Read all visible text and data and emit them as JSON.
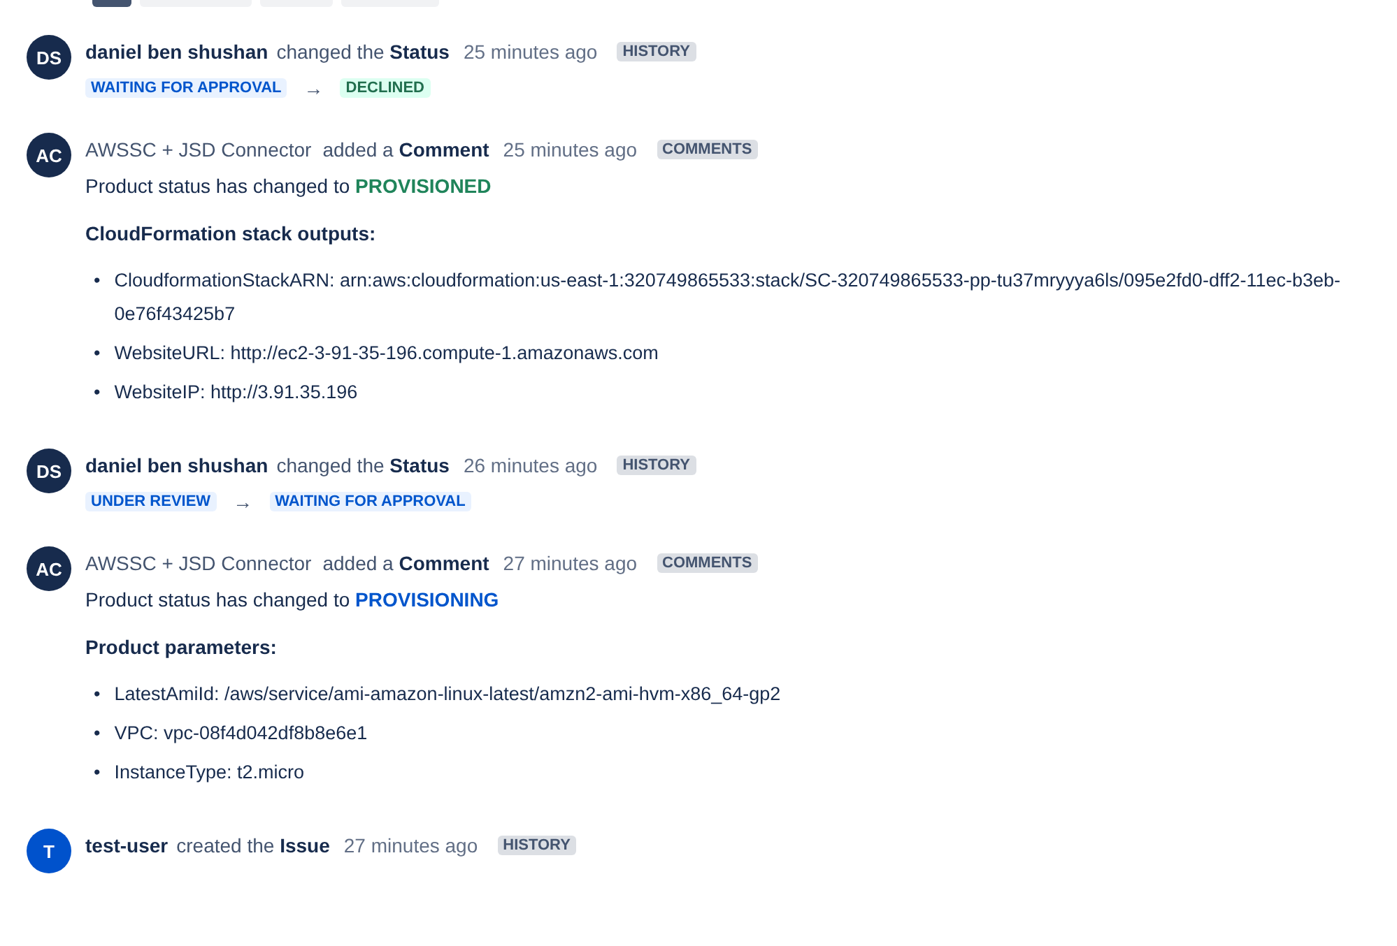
{
  "top_tabs": [
    {
      "selected": true
    },
    {
      "selected": false
    },
    {
      "selected": false
    },
    {
      "selected": false
    }
  ],
  "entries": [
    {
      "kind": "status_change",
      "initials": "DS",
      "color": "#172b4d",
      "author": {
        "name": "daniel ben shushan",
        "kind": "user"
      },
      "action": "changed the **Status**",
      "time": "25 minutes ago",
      "tag": "HISTORY",
      "from": {
        "label": "WAITING FOR APPROVAL",
        "kind": "in_progress"
      },
      "arrow": "→",
      "to": {
        "label": "DECLINED",
        "kind": "done"
      }
    },
    {
      "kind": "comment",
      "initials": "AC",
      "color": "#172b4d",
      "author": {
        "name": "AWSSC + JSD Connector",
        "kind": "app"
      },
      "action": "added a **Comment**",
      "time": "25 minutes ago",
      "tag": "COMMENTS",
      "text": "Product status has changed to",
      "status": {
        "label": "PROVISIONED",
        "kind": "done"
      },
      "heading": "CloudFormation stack outputs:",
      "items": [
        {
          "bullet": "•",
          "text": "CloudformationStackARN: arn:aws:cloudformation:us-east-1:320749865533:stack/SC-320749865533-pp-tu37mryyya6ls/095e2fd0-dff2-11ec-b3eb-0e76f43425b7"
        },
        {
          "bullet": "•",
          "text": "WebsiteURL: http://ec2-3-91-35-196.compute-1.amazonaws.com"
        },
        {
          "bullet": "•",
          "text": "WebsiteIP: http://3.91.35.196"
        }
      ]
    },
    {
      "kind": "status_change",
      "initials": "DS",
      "color": "#172b4d",
      "author": {
        "name": "daniel ben shushan",
        "kind": "user"
      },
      "action": "changed the **Status**",
      "time": "26 minutes ago",
      "tag": "HISTORY",
      "from": {
        "label": "UNDER REVIEW",
        "kind": "in_progress"
      },
      "arrow": "→",
      "to": {
        "label": "WAITING FOR APPROVAL",
        "kind": "in_progress"
      }
    },
    {
      "kind": "comment",
      "initials": "AC",
      "color": "#172b4d",
      "author": {
        "name": "AWSSC + JSD Connector",
        "kind": "app"
      },
      "action": "added a **Comment**",
      "time": "27 minutes ago",
      "tag": "COMMENTS",
      "text": "Product status has changed to",
      "status": {
        "label": "PROVISIONING",
        "kind": "in_progress"
      },
      "heading": "Product parameters:",
      "items": [
        {
          "bullet": "•",
          "text": "LatestAmiId: /aws/service/ami-amazon-linux-latest/amzn2-ami-hvm-x86_64-gp2"
        },
        {
          "bullet": "•",
          "text": "VPC: vpc-08f4d042df8b8e6e1"
        },
        {
          "bullet": "•",
          "text": "InstanceType: t2.micro"
        }
      ]
    },
    {
      "kind": "created",
      "initials": "T",
      "color": "#0052cc",
      "author": {
        "name": "test-user",
        "kind": "user"
      },
      "action": "created the **Issue**",
      "time": "27 minutes ago",
      "tag": "HISTORY"
    }
  ]
}
